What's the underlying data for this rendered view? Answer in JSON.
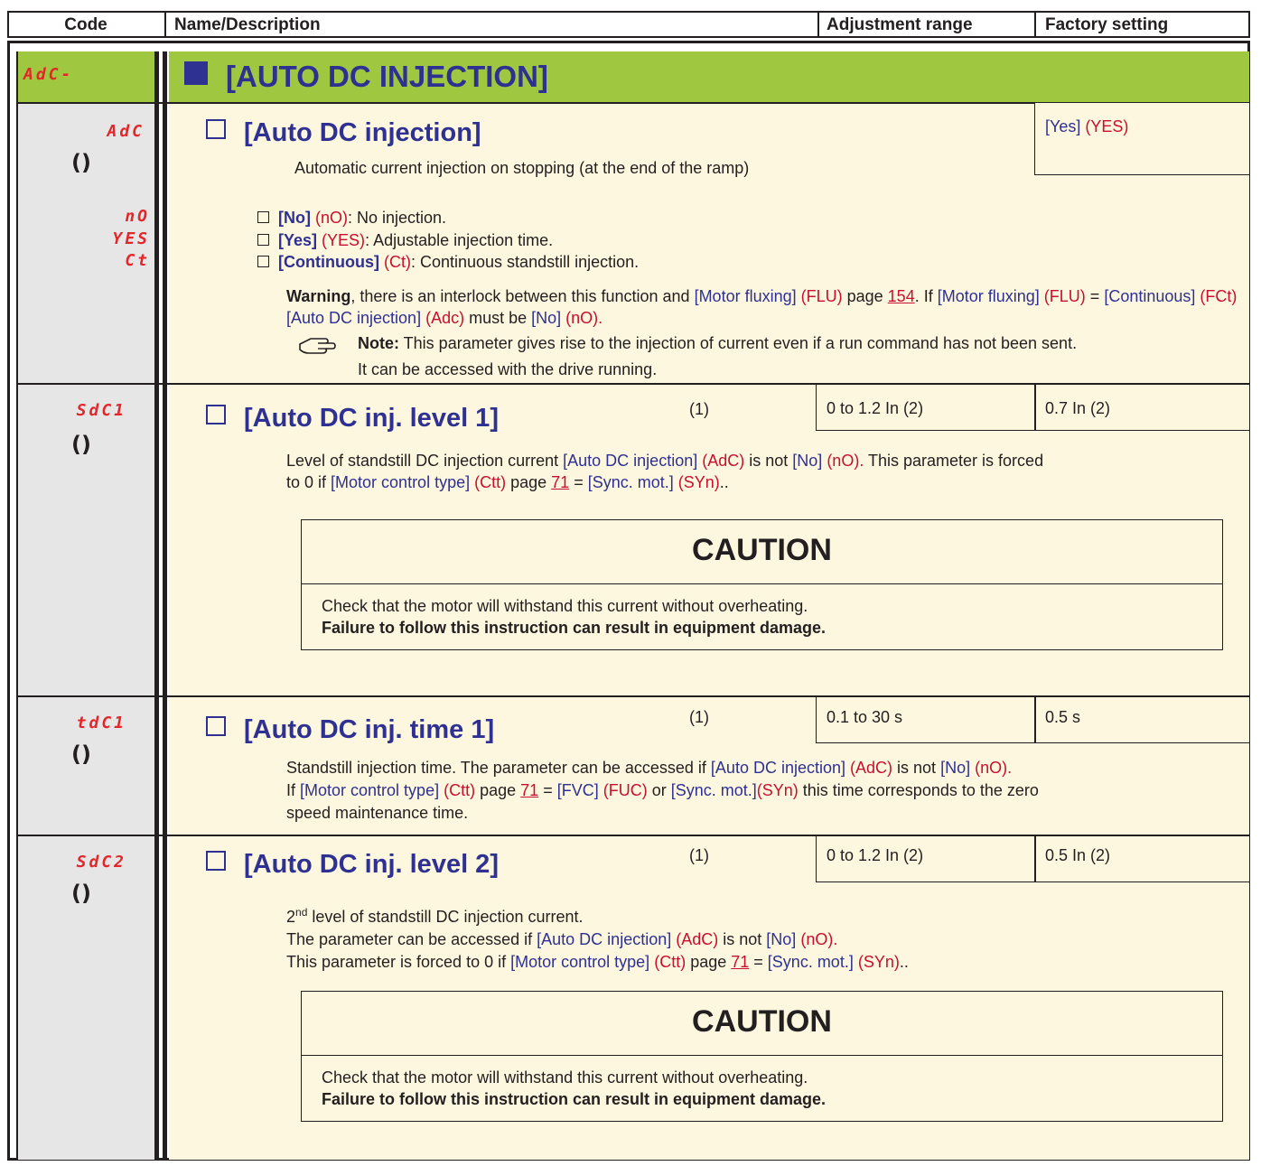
{
  "header": {
    "code": "Code",
    "name": "Name/Description",
    "range": "Adjustment range",
    "factory": "Factory setting"
  },
  "menu": {
    "code": "AdC-",
    "title": "[AUTO DC INJECTION]"
  },
  "params": {
    "adc": {
      "code": "AdC",
      "title": "[Auto DC injection]",
      "factory_blue": "[Yes]",
      "factory_red": "(YES)",
      "desc": "Automatic current injection on stopping (at the end of the ramp)",
      "options": [
        {
          "code": "nO",
          "label": "[No]",
          "code_text": "(nO)",
          "desc": ": No injection."
        },
        {
          "code": "YES",
          "label": "[Yes]",
          "code_text": "(YES)",
          "desc": ": Adjustable injection time."
        },
        {
          "code": "Ct",
          "label": "[Continuous]",
          "code_text": "(Ct)",
          "desc": ": Continuous standstill injection."
        }
      ],
      "warning": {
        "w_bold": "Warning",
        "w1": ", there is an interlock between this function and ",
        "w2": "[Motor fluxing]",
        "w3": "(FLU)",
        "w4": " page ",
        "w5": "154",
        "w6": ". If ",
        "w7": "[Motor fluxing]",
        "w8": "(FLU)",
        "w9": " = ",
        "w10": "[Continuous]",
        "w11": "(FCt)",
        "w12": "[Auto DC injection]",
        "w13": "(Adc)",
        "w14": " must be ",
        "w15": "[No]",
        "w16": "(nO)."
      },
      "note_bold": "Note:",
      "note1": " This parameter gives rise to the injection of current even if a run command has not been sent.",
      "note2": "It can be accessed with the drive running."
    },
    "sdc1": {
      "code": "SdC1",
      "title": "[Auto DC inj. level 1]",
      "footnote": "(1)",
      "range": "0 to 1.2 In (2)",
      "factory": "0.7 In (2)",
      "d1": "Level of standstill DC injection current ",
      "d2": "[Auto DC injection]",
      "d3": "(AdC)",
      "d4": " is not ",
      "d5": "[No]",
      "d6": "(nO).",
      "d7": " This parameter is forced",
      "d8": "to 0 if ",
      "d9": "[Motor control type]",
      "d10": "(Ctt)",
      "d11": " page ",
      "d12": "71",
      "d13": " = ",
      "d14": "[Sync. mot.]",
      "d15": "(SYn)",
      "d16": ".."
    },
    "tdc1": {
      "code": "tdC1",
      "title": "[Auto DC inj. time 1]",
      "footnote": "(1)",
      "range": "0.1 to 30 s",
      "factory": "0.5 s",
      "d1": "Standstill injection time. The parameter can be accessed if ",
      "d2": "[Auto DC injection]",
      "d3": "(AdC)",
      "d4": " is not ",
      "d5": "[No]",
      "d6": "(nO).",
      "d7": "If ",
      "d8": "[Motor control type]",
      "d9": "(Ctt)",
      "d10": " page ",
      "d11": "71",
      "d12": " = ",
      "d13": "[FVC]",
      "d14": "(FUC)",
      "d15": " or ",
      "d16": "[Sync. mot.]",
      "d17": "(SYn)",
      "d18": " this time corresponds to the zero",
      "d19": "speed maintenance time."
    },
    "sdc2": {
      "code": "SdC2",
      "title": "[Auto DC inj. level 2]",
      "footnote": "(1)",
      "range": "0 to 1.2 In (2)",
      "factory": "0.5 In (2)",
      "l1a": "2",
      "l1sup": "nd",
      "l1b": " level of standstill DC injection current.",
      "l2a": "The parameter can be accessed if ",
      "l2b": "[Auto DC injection]",
      "l2c": "(AdC)",
      "l2d": " is not ",
      "l2e": "[No]",
      "l2f": "(nO).",
      "l3a": "This parameter is forced to 0 if ",
      "l3b": "[Motor control type]",
      "l3c": "(Ctt)",
      "l3d": " page ",
      "l3e": "71",
      "l3f": " = ",
      "l3g": "[Sync. mot.]",
      "l3h": "(SYn)",
      "l3i": ".."
    }
  },
  "caution": {
    "title": "CAUTION",
    "text": "Check that the motor will withstand this current without overheating.",
    "bold": "Failure to follow this instruction can result in equipment damage."
  },
  "colors": {
    "menu_bg": "#9fc740",
    "content_bg": "#fdf7df",
    "code_bg": "#e6e6e7",
    "code_red": "#e3262a",
    "param_blue": "#2e3192"
  }
}
